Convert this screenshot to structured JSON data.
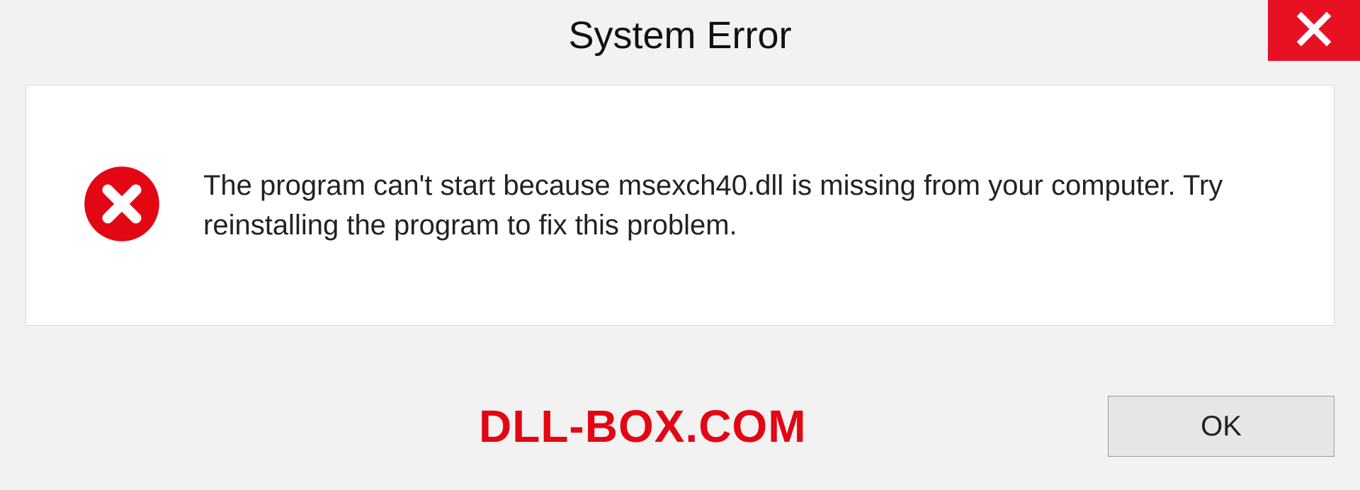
{
  "title": "System Error",
  "message": "The program can't start because msexch40.dll is missing from your computer. Try reinstalling the program to fix this problem.",
  "brand": "DLL-BOX.COM",
  "ok_label": "OK"
}
